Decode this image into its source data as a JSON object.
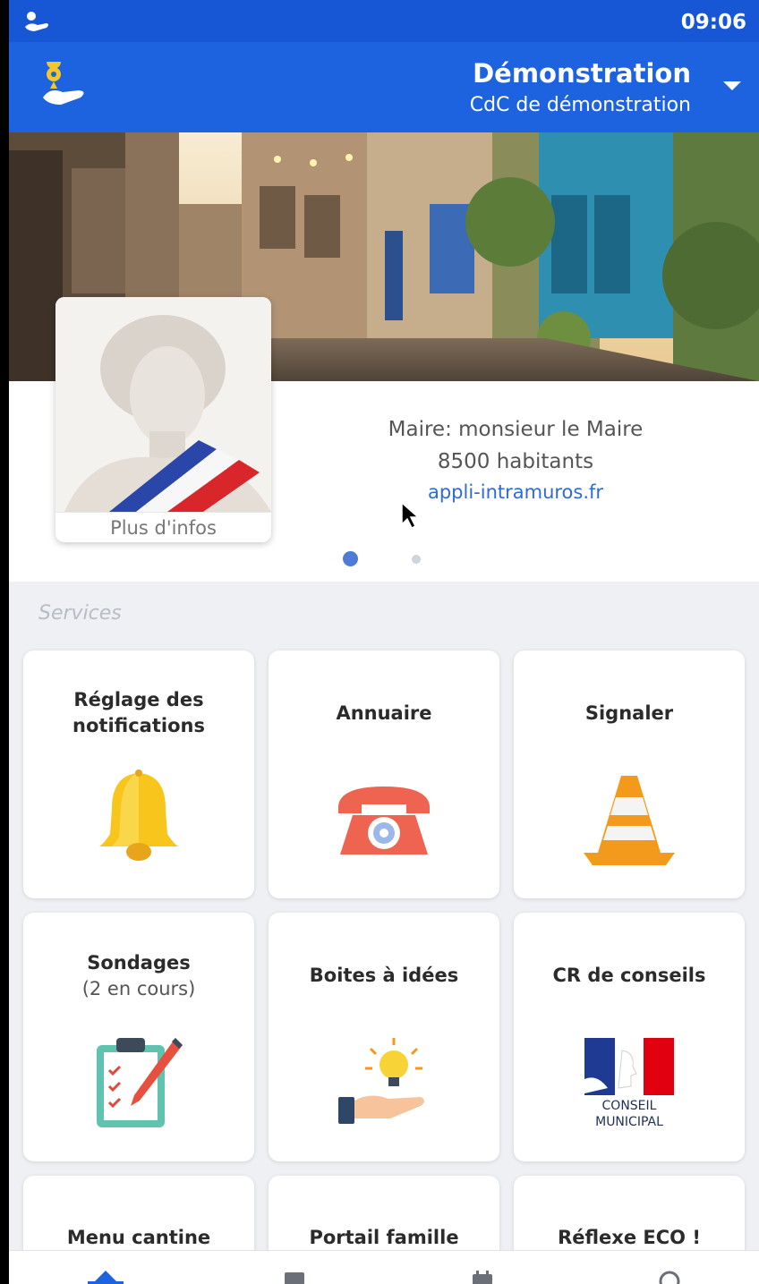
{
  "status_bar": {
    "time": "09:06"
  },
  "header": {
    "title": "Démonstration",
    "subtitle": "CdC de démonstration"
  },
  "mayor_card": {
    "more_info": "Plus d'infos",
    "mayor": "Maire: monsieur le Maire",
    "inhabitants": "8500 habitants",
    "website": "appli-intramuros.fr",
    "carousel_active_index": 0,
    "carousel_count": 2
  },
  "services": {
    "section_label": "Services",
    "tiles": [
      {
        "label_line1": "Réglage des",
        "label_line2": "notifications",
        "icon": "bell-icon"
      },
      {
        "label": "Annuaire",
        "icon": "telephone-icon"
      },
      {
        "label": "Signaler",
        "icon": "traffic-cone-icon"
      },
      {
        "label": "Sondages",
        "sublabel": "(2 en cours)",
        "icon": "clipboard-icon"
      },
      {
        "label": "Boites à idées",
        "icon": "idea-lightbulb-icon"
      },
      {
        "label": "CR de conseils",
        "icon": "conseil-municipal-logo",
        "logo_text_1": "CONSEIL",
        "logo_text_2": "MUNICIPAL"
      },
      {
        "label": "Menu cantine"
      },
      {
        "label": "Portail famille"
      },
      {
        "label": "Réflexe ECO !"
      }
    ]
  },
  "colors": {
    "primary": "#1d63e0",
    "status_bar": "#1757d6",
    "link": "#2f6bd6",
    "background": "#eef0f4"
  }
}
